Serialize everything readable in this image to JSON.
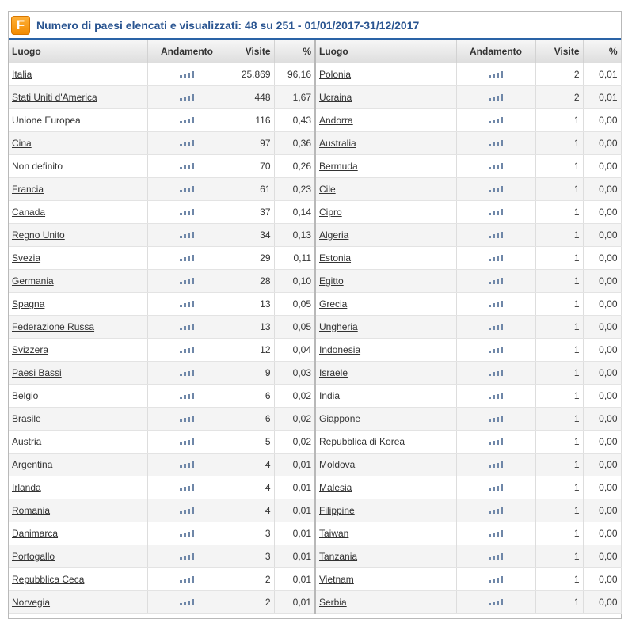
{
  "header": {
    "logo_letter": "F",
    "title": "Numero di paesi elencati e visualizzati: 48 su 251 - 01/01/2017-31/12/2017"
  },
  "columns": {
    "place": "Luogo",
    "trend": "Andamento",
    "visits": "Visite",
    "percent": "%"
  },
  "left_rows": [
    {
      "place": "Italia",
      "link": true,
      "visits": "25.869",
      "percent": "96,16"
    },
    {
      "place": "Stati Uniti d'America",
      "link": true,
      "visits": "448",
      "percent": "1,67"
    },
    {
      "place": "Unione Europea",
      "link": false,
      "visits": "116",
      "percent": "0,43"
    },
    {
      "place": "Cina",
      "link": true,
      "visits": "97",
      "percent": "0,36"
    },
    {
      "place": "Non definito",
      "link": false,
      "visits": "70",
      "percent": "0,26"
    },
    {
      "place": "Francia",
      "link": true,
      "visits": "61",
      "percent": "0,23"
    },
    {
      "place": "Canada",
      "link": true,
      "visits": "37",
      "percent": "0,14"
    },
    {
      "place": "Regno Unito",
      "link": true,
      "visits": "34",
      "percent": "0,13"
    },
    {
      "place": "Svezia",
      "link": true,
      "visits": "29",
      "percent": "0,11"
    },
    {
      "place": "Germania",
      "link": true,
      "visits": "28",
      "percent": "0,10"
    },
    {
      "place": "Spagna",
      "link": true,
      "visits": "13",
      "percent": "0,05"
    },
    {
      "place": "Federazione Russa",
      "link": true,
      "visits": "13",
      "percent": "0,05"
    },
    {
      "place": "Svizzera",
      "link": true,
      "visits": "12",
      "percent": "0,04"
    },
    {
      "place": "Paesi Bassi",
      "link": true,
      "visits": "9",
      "percent": "0,03"
    },
    {
      "place": "Belgio",
      "link": true,
      "visits": "6",
      "percent": "0,02"
    },
    {
      "place": "Brasile",
      "link": true,
      "visits": "6",
      "percent": "0,02"
    },
    {
      "place": "Austria",
      "link": true,
      "visits": "5",
      "percent": "0,02"
    },
    {
      "place": "Argentina",
      "link": true,
      "visits": "4",
      "percent": "0,01"
    },
    {
      "place": "Irlanda",
      "link": true,
      "visits": "4",
      "percent": "0,01"
    },
    {
      "place": "Romania",
      "link": true,
      "visits": "4",
      "percent": "0,01"
    },
    {
      "place": "Danimarca",
      "link": true,
      "visits": "3",
      "percent": "0,01"
    },
    {
      "place": "Portogallo",
      "link": true,
      "visits": "3",
      "percent": "0,01"
    },
    {
      "place": "Repubblica Ceca",
      "link": true,
      "visits": "2",
      "percent": "0,01"
    },
    {
      "place": "Norvegia",
      "link": true,
      "visits": "2",
      "percent": "0,01"
    }
  ],
  "right_rows": [
    {
      "place": "Polonia",
      "link": true,
      "visits": "2",
      "percent": "0,01"
    },
    {
      "place": "Ucraina",
      "link": true,
      "visits": "2",
      "percent": "0,01"
    },
    {
      "place": "Andorra",
      "link": true,
      "visits": "1",
      "percent": "0,00"
    },
    {
      "place": "Australia",
      "link": true,
      "visits": "1",
      "percent": "0,00"
    },
    {
      "place": "Bermuda",
      "link": true,
      "visits": "1",
      "percent": "0,00"
    },
    {
      "place": "Cile",
      "link": true,
      "visits": "1",
      "percent": "0,00"
    },
    {
      "place": "Cipro",
      "link": true,
      "visits": "1",
      "percent": "0,00"
    },
    {
      "place": "Algeria",
      "link": true,
      "visits": "1",
      "percent": "0,00"
    },
    {
      "place": "Estonia",
      "link": true,
      "visits": "1",
      "percent": "0,00"
    },
    {
      "place": "Egitto",
      "link": true,
      "visits": "1",
      "percent": "0,00"
    },
    {
      "place": "Grecia",
      "link": true,
      "visits": "1",
      "percent": "0,00"
    },
    {
      "place": "Ungheria",
      "link": true,
      "visits": "1",
      "percent": "0,00"
    },
    {
      "place": "Indonesia",
      "link": true,
      "visits": "1",
      "percent": "0,00"
    },
    {
      "place": "Israele",
      "link": true,
      "visits": "1",
      "percent": "0,00"
    },
    {
      "place": "India",
      "link": true,
      "visits": "1",
      "percent": "0,00"
    },
    {
      "place": "Giappone",
      "link": true,
      "visits": "1",
      "percent": "0,00"
    },
    {
      "place": "Repubblica di Korea",
      "link": true,
      "visits": "1",
      "percent": "0,00"
    },
    {
      "place": "Moldova",
      "link": true,
      "visits": "1",
      "percent": "0,00"
    },
    {
      "place": "Malesia",
      "link": true,
      "visits": "1",
      "percent": "0,00"
    },
    {
      "place": "Filippine",
      "link": true,
      "visits": "1",
      "percent": "0,00"
    },
    {
      "place": "Taiwan",
      "link": true,
      "visits": "1",
      "percent": "0,00"
    },
    {
      "place": "Tanzania",
      "link": true,
      "visits": "1",
      "percent": "0,00"
    },
    {
      "place": "Vietnam",
      "link": true,
      "visits": "1",
      "percent": "0,00"
    },
    {
      "place": "Serbia",
      "link": true,
      "visits": "1",
      "percent": "0,00"
    }
  ],
  "icons": {
    "trend": "bar-chart-icon"
  },
  "colors": {
    "title": "#2a5591",
    "header_rule": "#2a63a6",
    "logo": "#f28a00",
    "trend_bars": "#6f87a8"
  }
}
